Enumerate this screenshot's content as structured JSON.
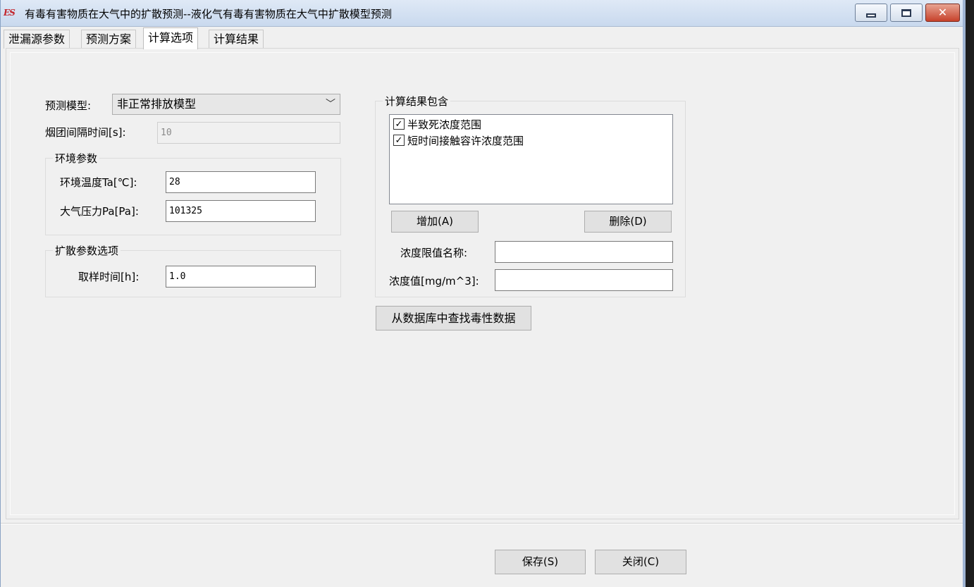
{
  "window": {
    "title": "有毒有害物质在大气中的扩散预测--液化气有毒有害物质在大气中扩散模型预测",
    "app_icon_text": "ES",
    "controls": {
      "minimize": "minimize",
      "maximize": "maximize",
      "close": "✕"
    }
  },
  "tabs": [
    {
      "label": "泄漏源参数",
      "active": false
    },
    {
      "label": "预测方案",
      "active": false
    },
    {
      "label": "计算选项",
      "active": true
    },
    {
      "label": "计算结果",
      "active": false
    }
  ],
  "form": {
    "model_label": "预测模型:",
    "model_value": "非正常排放模型",
    "interval_label": "烟团间隔时间[s]:",
    "interval_value": "10",
    "env_group_title": "环境参数",
    "temp_label": "环境温度Ta[℃]:",
    "temp_value": "28",
    "pressure_label": "大气压力Pa[Pa]:",
    "pressure_value": "101325",
    "diffusion_group_title": "扩散参数选项",
    "sample_label": "取样时间[h]:",
    "sample_value": "1.0"
  },
  "results": {
    "group_title": "计算结果包含",
    "items": [
      {
        "label": "半致死浓度范围",
        "checked": true
      },
      {
        "label": "短时间接触容许浓度范围",
        "checked": true
      }
    ],
    "check_glyph": "✓",
    "add_button": "增加(A)",
    "delete_button": "删除(D)",
    "limit_name_label": "浓度限值名称:",
    "limit_name_value": "",
    "limit_value_label": "浓度值[mg/m^3]:",
    "limit_value_value": "",
    "db_button": "从数据库中查找毒性数据"
  },
  "footer": {
    "save_button": "保存(S)",
    "close_button": "关闭(C)"
  }
}
